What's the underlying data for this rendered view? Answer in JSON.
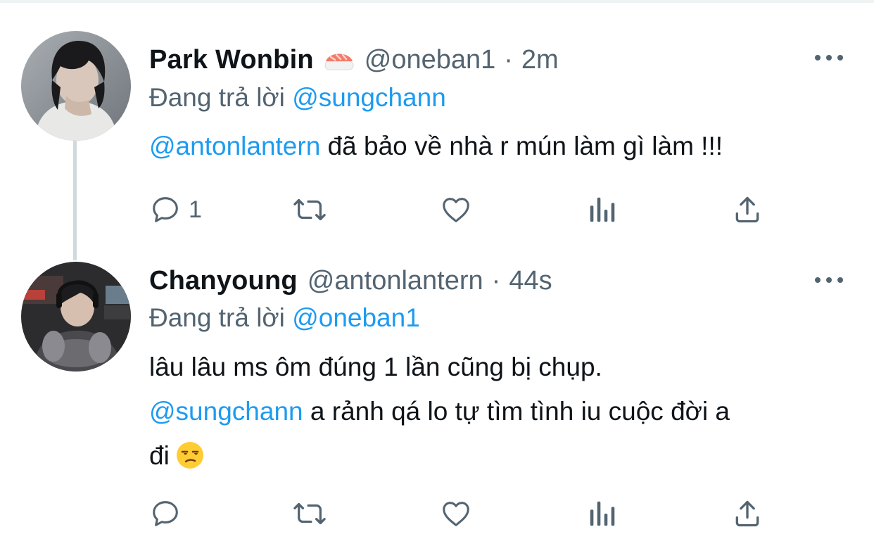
{
  "tweets": [
    {
      "display_name": "Park Wonbin",
      "name_emoji": "sushi-emoji",
      "handle": "@oneban1",
      "separator": "·",
      "time": "2m",
      "reply_prefix": "Đang trả lời",
      "reply_to": "@sungchann",
      "body_mention": "@antonlantern",
      "body_text": " đã bảo về nhà r mún làm gì làm !!!",
      "reply_count": "1",
      "icons": {
        "avatar": "avatar-photo",
        "more": "more-options-icon",
        "reply": "reply-icon",
        "retweet": "retweet-icon",
        "like": "like-icon",
        "analytics": "analytics-icon",
        "share": "share-icon"
      }
    },
    {
      "display_name": "Chanyoung",
      "handle": "@antonlantern",
      "separator": "·",
      "time": "44s",
      "reply_prefix": "Đang trả lời",
      "reply_to": "@oneban1",
      "body_line1": "lâu lâu ms ôm đúng 1 lần cũng bị chụp.",
      "body_mention": "@sungchann",
      "body_line2": " a rảnh qá lo tự tìm tình iu cuộc đời a",
      "body_line3": "đi",
      "body_emoji": "unamused-face-emoji",
      "reply_count": ""
    }
  ],
  "colors": {
    "text_primary": "#0f1419",
    "text_secondary": "#536471",
    "link": "#1d9bf0",
    "thread_line": "#cfd9de"
  }
}
